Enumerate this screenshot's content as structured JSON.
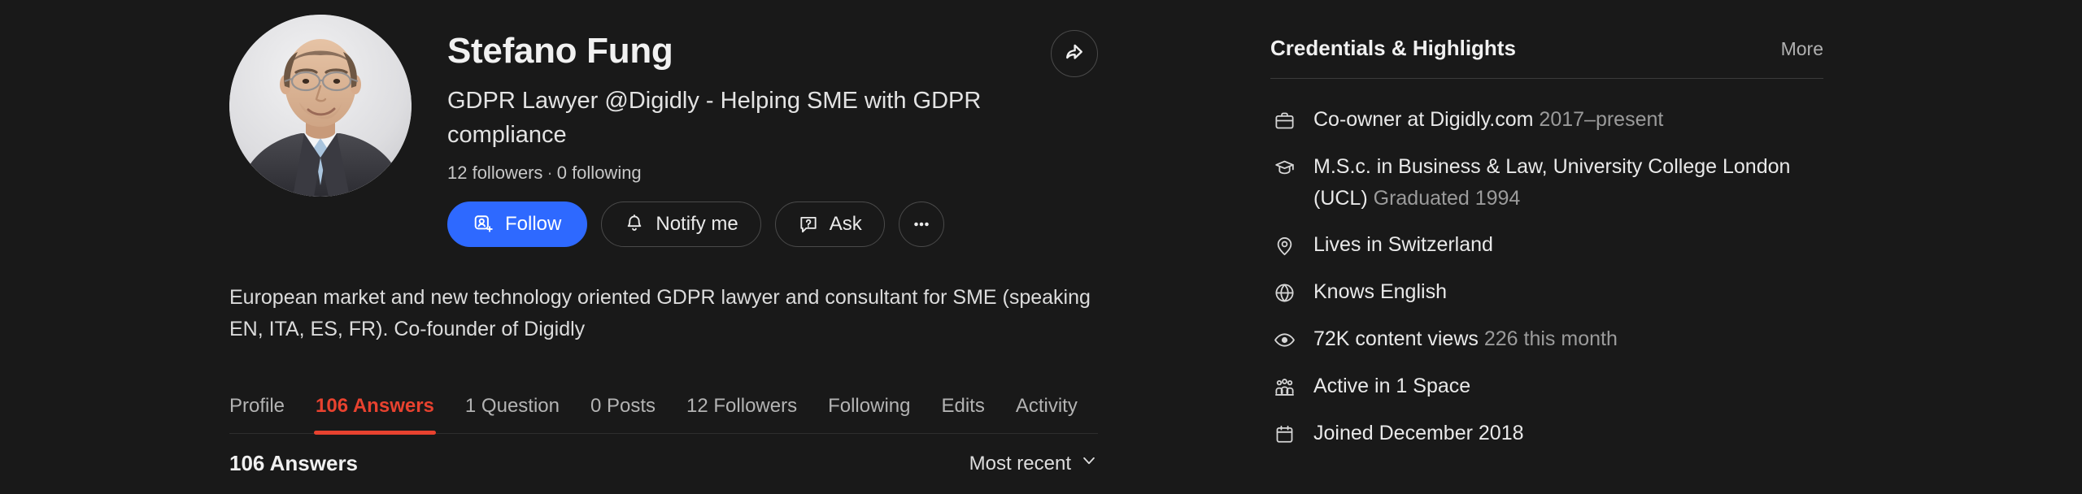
{
  "profile": {
    "name": "Stefano Fung",
    "headline": "GDPR Lawyer @Digidly - Helping SME with GDPR compliance",
    "followers": "12 followers",
    "separator": "·",
    "following": "0 following",
    "bio": "European market and new technology oriented GDPR lawyer and consultant for SME (speaking EN, ITA, ES, FR). Co-founder of Digidly",
    "avatar_alt": "profile-photo",
    "share_icon": "share-arrow-icon"
  },
  "actions": {
    "follow": {
      "label": "Follow",
      "icon": "person-add-icon",
      "color": "#2e69ff"
    },
    "notify": {
      "label": "Notify me",
      "icon": "bell-icon"
    },
    "ask": {
      "label": "Ask",
      "icon": "question-bubble-icon"
    },
    "more": {
      "label": "•••",
      "icon": "ellipsis-icon"
    }
  },
  "tabs": [
    {
      "label": "Profile",
      "active": false
    },
    {
      "label": "106 Answers",
      "active": true
    },
    {
      "label": "1 Question",
      "active": false
    },
    {
      "label": "0 Posts",
      "active": false
    },
    {
      "label": "12 Followers",
      "active": false
    },
    {
      "label": "Following",
      "active": false
    },
    {
      "label": "Edits",
      "active": false
    },
    {
      "label": "Activity",
      "active": false
    }
  ],
  "content_header": {
    "title": "106 Answers",
    "sort_label": "Most recent",
    "sort_icon": "chevron-down-icon"
  },
  "sidebar": {
    "title": "Credentials & Highlights",
    "more_label": "More",
    "items": [
      {
        "icon": "briefcase-icon",
        "text": "Co-owner at Digidly.com",
        "meta": "2017–present"
      },
      {
        "icon": "graduation-cap-icon",
        "text": "M.S.c. in Business & Law, University College London (UCL)",
        "meta": "Graduated 1994"
      },
      {
        "icon": "location-pin-icon",
        "text": "Lives in Switzerland",
        "meta": ""
      },
      {
        "icon": "globe-icon",
        "text": "Knows English",
        "meta": ""
      },
      {
        "icon": "eye-icon",
        "text": "72K content views",
        "meta": "226 this month"
      },
      {
        "icon": "people-group-icon",
        "text": "Active in 1 Space",
        "meta": ""
      },
      {
        "icon": "calendar-icon",
        "text": "Joined December 2018",
        "meta": ""
      }
    ]
  },
  "theme": {
    "background": "#191919",
    "accent_red": "#e8422f",
    "accent_blue": "#2e69ff",
    "text_primary": "#f1f1f1",
    "text_muted": "#9b9b9b"
  }
}
